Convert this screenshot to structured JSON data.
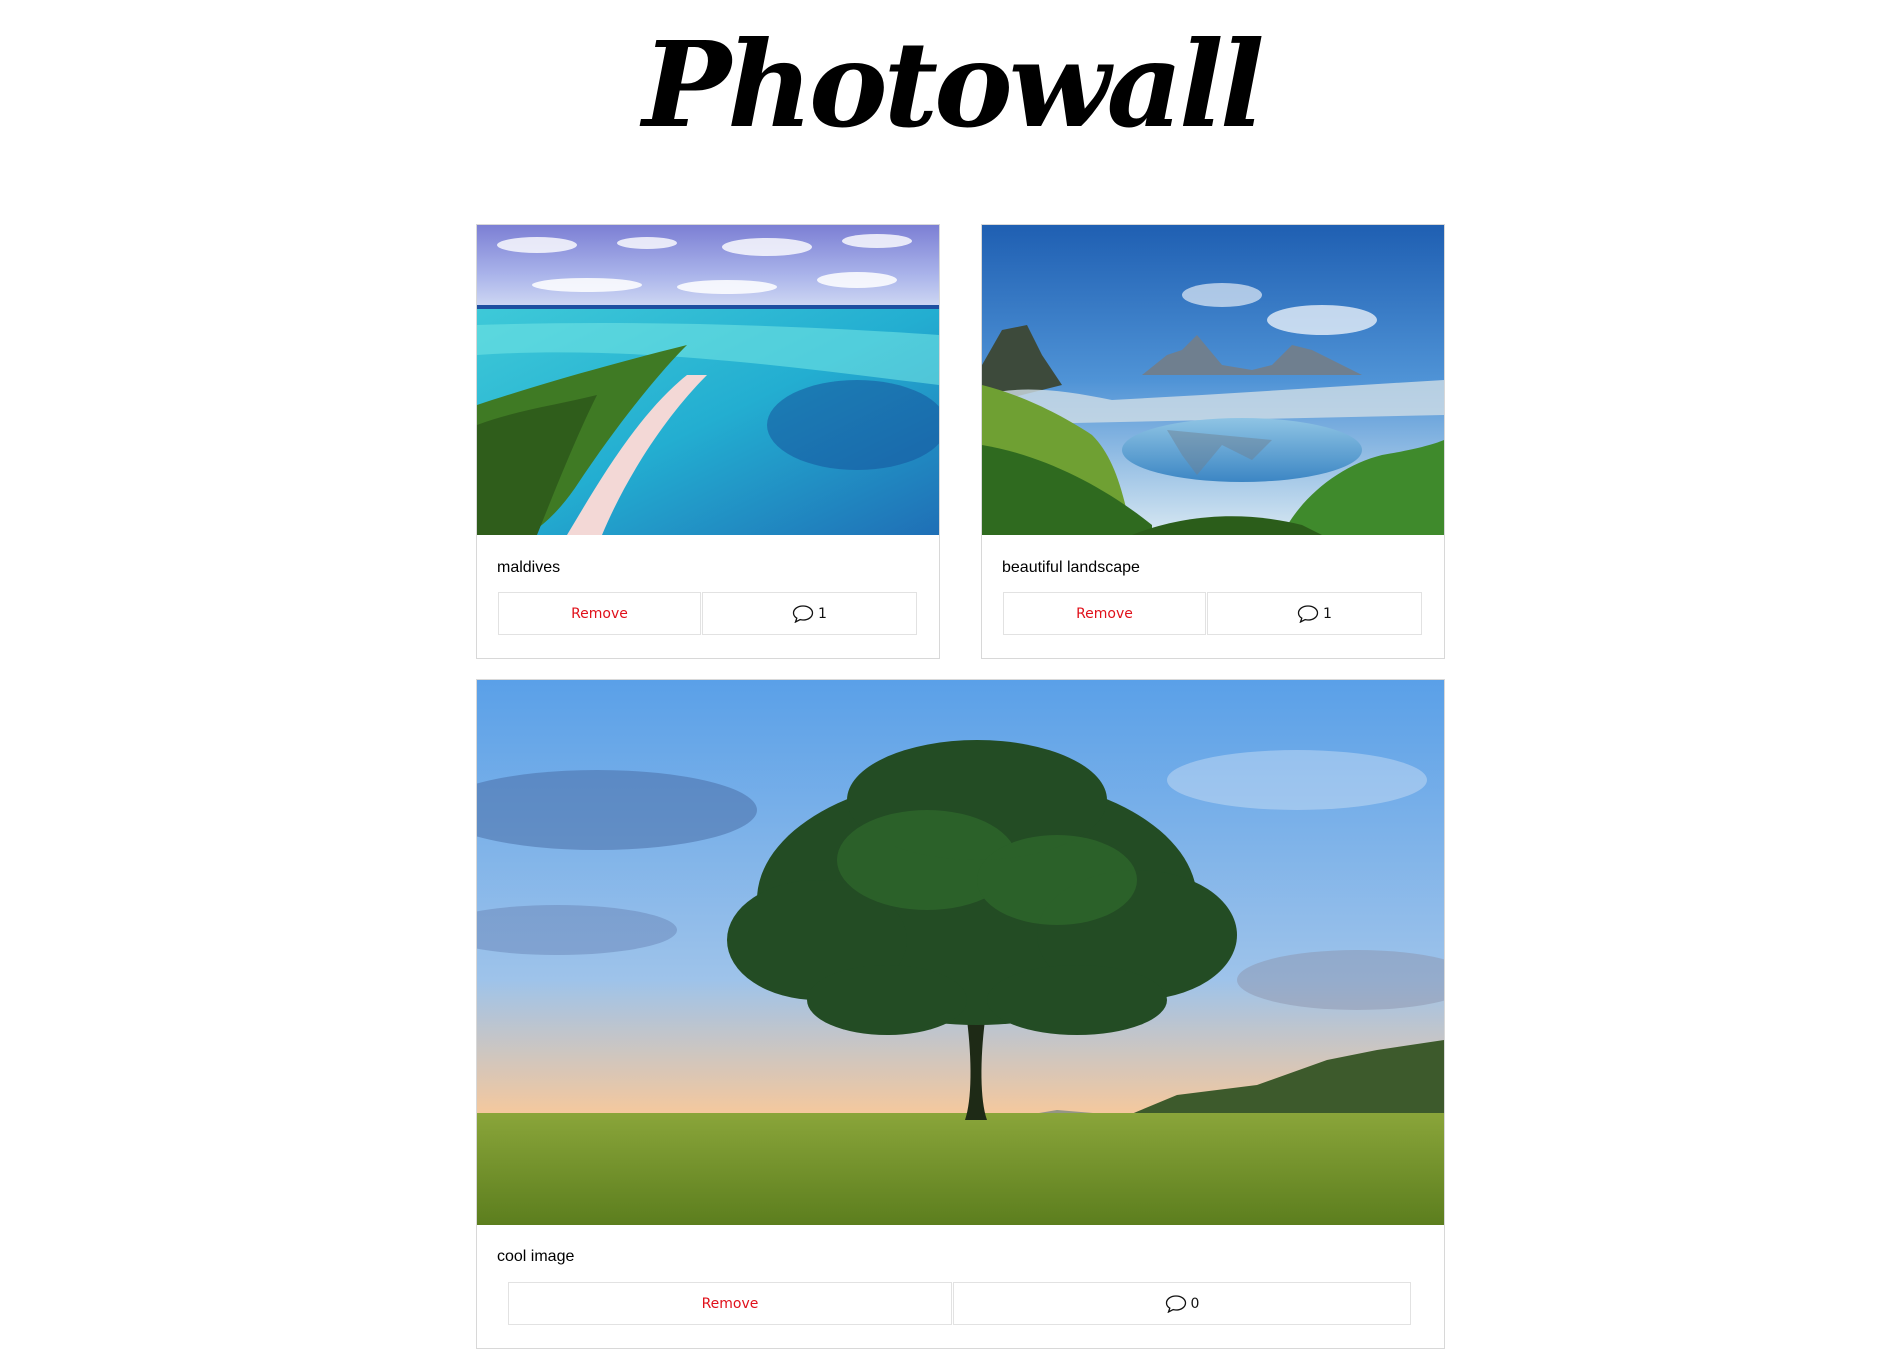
{
  "header": {
    "title": "Photowall"
  },
  "posts": [
    {
      "description": "maldives",
      "remove_label": "Remove",
      "comment_count": "1",
      "comment_icon": "speech-bubble-icon"
    },
    {
      "description": "beautiful landscape",
      "remove_label": "Remove",
      "comment_count": "1",
      "comment_icon": "speech-bubble-icon"
    },
    {
      "description": "cool image",
      "remove_label": "Remove",
      "comment_count": "0",
      "comment_icon": "speech-bubble-icon"
    }
  ],
  "colors": {
    "remove_text": "#e0101a",
    "border": "#d8d8d8"
  }
}
